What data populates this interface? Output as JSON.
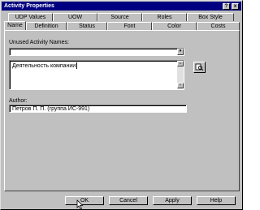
{
  "window": {
    "title": "Activity Properties",
    "close_glyph": "x",
    "help_glyph": "?"
  },
  "tabs": {
    "back_row": [
      {
        "label": "UDP Values",
        "name": "tab-udp-values"
      },
      {
        "label": "UOW",
        "name": "tab-uow"
      },
      {
        "label": "Source",
        "name": "tab-source"
      },
      {
        "label": "Roles",
        "name": "tab-roles"
      },
      {
        "label": "Box Style",
        "name": "tab-box-style"
      }
    ],
    "front_row": [
      {
        "label": "Name",
        "name": "tab-name"
      },
      {
        "label": "Definition",
        "name": "tab-definition"
      },
      {
        "label": "Status",
        "name": "tab-status"
      },
      {
        "label": "Font",
        "name": "tab-font"
      },
      {
        "label": "Color",
        "name": "tab-color"
      },
      {
        "label": "Costs",
        "name": "tab-costs"
      }
    ],
    "active": "Name"
  },
  "name_tab": {
    "unused_names_label": "Unused Activity Names:",
    "unused_names_value": "",
    "activity_name_value": "Деятельность компании",
    "author_label": "Author:",
    "author_value": "Петров П. П. (группа ИС-991)"
  },
  "icons": {
    "dropdown": "chevron-down-icon",
    "browse": "search-icon",
    "scroll_up": "scroll-up-icon",
    "scroll_down": "scroll-down-icon",
    "cursor": "mouse-pointer-icon"
  },
  "buttons": {
    "ok": "OK",
    "cancel": "Cancel",
    "apply": "Apply",
    "help": "Help"
  },
  "colors": {
    "title_bar": "#000080",
    "face": "#c0c0c0"
  }
}
